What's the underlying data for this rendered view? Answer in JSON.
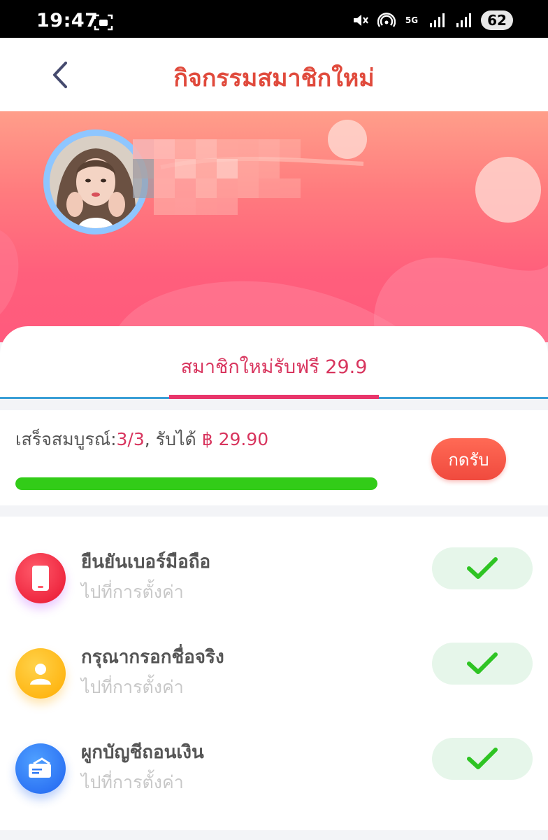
{
  "status_bar": {
    "time": "19:47",
    "network": "5G",
    "battery": "62",
    "icons": [
      "screenshot-icon",
      "mute-icon",
      "hotspot-icon",
      "signal-icon",
      "signal-icon",
      "battery-icon"
    ]
  },
  "header": {
    "title": "กิจกรรมสมาชิกใหม่",
    "back_icon": "chevron-left-icon"
  },
  "profile": {
    "avatar_icon": "avatar",
    "name_obscured": true
  },
  "tab": {
    "label": "สมาชิกใหม่รับฟรี 29.9"
  },
  "progress": {
    "prefix": "เสร็จสมบูรณ์:",
    "count": "3/3",
    "middle": ", รับได้ ",
    "reward": "฿ 29.90",
    "fraction": 1.0,
    "claim_label": "กดรับ"
  },
  "tasks": [
    {
      "title": "ยืนยันเบอร์มือถือ",
      "subtitle": "ไปที่การตั้งค่า",
      "icon": "phone-icon",
      "status": "done"
    },
    {
      "title": "กรุณากรอกชื่อจริง",
      "subtitle": "ไปที่การตั้งค่า",
      "icon": "person-icon",
      "status": "done"
    },
    {
      "title": "ผูกบัญชีถอนเงิน",
      "subtitle": "ไปที่การตั้งค่า",
      "icon": "card-icon",
      "status": "done"
    }
  ],
  "colors": {
    "accent": "#d8355e",
    "title": "#e04a3c",
    "progress": "#32cc18",
    "check": "#2ec423",
    "tab_line": "#3a9fd6"
  }
}
